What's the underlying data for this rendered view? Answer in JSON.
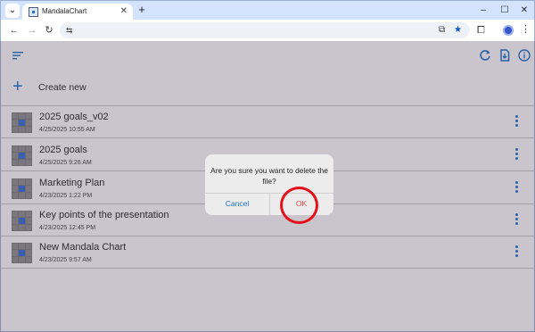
{
  "browser": {
    "tab_title": "MandalaChart",
    "tab_close": "✕",
    "new_tab": "+",
    "tab_menu": "⌄",
    "window": {
      "minimize": "–",
      "maximize": "☐",
      "close": "✕"
    },
    "nav": {
      "back": "←",
      "forward": "→",
      "reload": "↻"
    },
    "omnibox": {
      "site_info": "⇆",
      "install_icon": "⧉",
      "bookmark_icon": "★"
    },
    "extensions_icon": "⧠",
    "menu_icon": "⋮"
  },
  "app": {
    "create_label": "Create new",
    "plus_icon": "+",
    "files": [
      {
        "title": "2025 goals_v02",
        "date": "4/25/2025 10:55 AM"
      },
      {
        "title": "2025 goals",
        "date": "4/25/2025 9:26 AM"
      },
      {
        "title": "Marketing Plan",
        "date": "4/23/2025 1:22 PM"
      },
      {
        "title": "Key points of the presentation",
        "date": "4/23/2025 12:45 PM"
      },
      {
        "title": "New Mandala Chart",
        "date": "4/23/2025 9:57 AM"
      }
    ]
  },
  "dialog": {
    "message": "Are you sure you want to delete the file?",
    "cancel_label": "Cancel",
    "ok_label": "OK"
  },
  "colors": {
    "accent": "#1a73c9",
    "ok_text": "#e0453a",
    "annotation": "#e3121a",
    "tab_strip": "#d3e3fd"
  }
}
